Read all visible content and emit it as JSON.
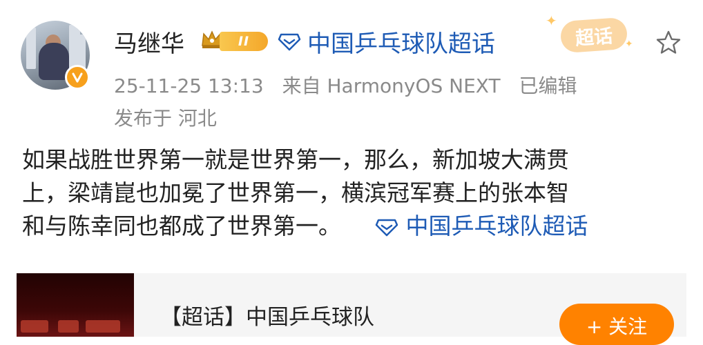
{
  "post": {
    "author": {
      "name": "马继华",
      "level": "II"
    },
    "header_topic": "中国乒乓球队超话",
    "meta": {
      "timestamp": "25-11-25 13:13",
      "source": "来自 HarmonyOS NEXT",
      "edited": "已编辑"
    },
    "location": "发布于 河北",
    "badge": "超话",
    "content": {
      "line1": "如果战胜世界第一就是世界第一，那么，新加坡大满贯",
      "line2": "上，梁靖崑也加冕了世界第一，横滨冠军赛上的张本智",
      "line3": "和与陈幸同也都成了世界第一。",
      "topic": "中国乒乓球队超话"
    }
  },
  "card": {
    "title": "【超话】中国乒乓球队",
    "follow_label": "+ 关注"
  },
  "colors": {
    "link_blue": "#1e5bb5",
    "accent_orange": "#ff8200",
    "meta_gray": "#8a8a8a",
    "vip_gold": "#f4a72a"
  },
  "icons": [
    "vip-crown-icon",
    "topic-diamond-icon",
    "star-icon",
    "verified-badge-icon"
  ]
}
